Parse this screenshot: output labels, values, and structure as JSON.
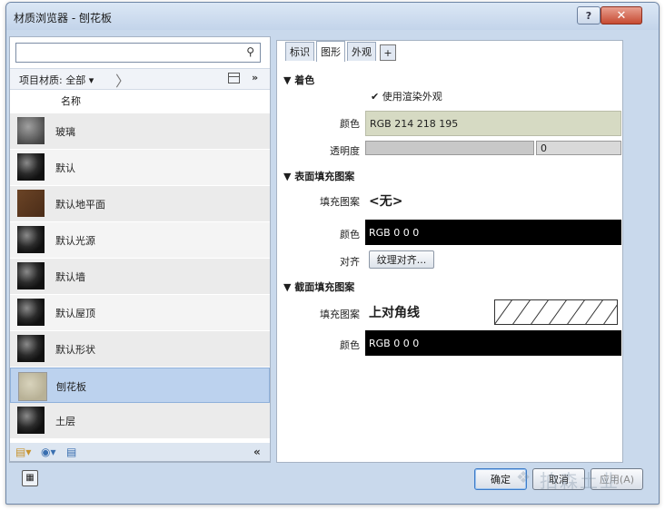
{
  "window": {
    "title": "材质浏览器 - 刨花板",
    "help": "?",
    "close": "✕"
  },
  "left": {
    "search_placeholder": "",
    "filter_label": "项目材质: 全部 ▾",
    "column_header": "名称",
    "materials": [
      {
        "name": "玻璃",
        "thumb": "glass"
      },
      {
        "name": "默认",
        "thumb": "sphere"
      },
      {
        "name": "默认地平面",
        "thumb": "floor"
      },
      {
        "name": "默认光源",
        "thumb": "sphere"
      },
      {
        "name": "默认墙",
        "thumb": "sphere"
      },
      {
        "name": "默认屋顶",
        "thumb": "sphere"
      },
      {
        "name": "默认形状",
        "thumb": "sphere"
      },
      {
        "name": "刨花板",
        "thumb": "board",
        "selected": true
      },
      {
        "name": "土层",
        "thumb": "sphere"
      }
    ],
    "collapse": "«"
  },
  "tabs": [
    "标识",
    "图形",
    "外观",
    "+"
  ],
  "coloring": {
    "head": "▼ 着色",
    "use_render": "使用渲染外观",
    "color_label": "颜色",
    "color_value": "RGB 214 218 195",
    "color_hex": "#d6dac3",
    "transparency_label": "透明度",
    "transparency_value": "0"
  },
  "surface_pattern": {
    "head": "▼ 表面填充图案",
    "fill_label": "填充图案",
    "fill_value": "<无>",
    "color_label": "颜色",
    "color_value": "RGB 0 0 0",
    "align_label": "对齐",
    "align_button": "纹理对齐..."
  },
  "cut_pattern": {
    "head": "▼ 截面填充图案",
    "fill_label": "填充图案",
    "fill_value": "上对角线",
    "color_label": "颜色",
    "color_value": "RGB 0 0 0"
  },
  "buttons": {
    "ok": "确定",
    "cancel": "取消",
    "apply": "应用(A)"
  },
  "watermark": "拍森土业"
}
